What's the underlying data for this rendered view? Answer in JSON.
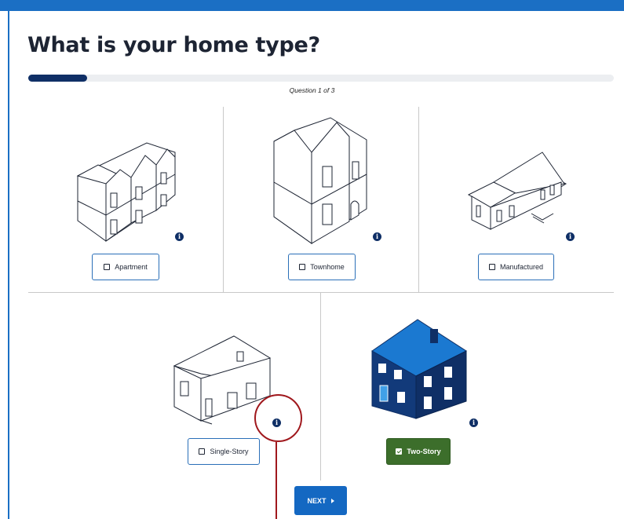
{
  "page": {
    "title": "What is your home type?",
    "progress_label": "Question 1 of 3",
    "progress_fraction": 0.1
  },
  "options": [
    {
      "label": "Apartment",
      "selected": false,
      "info": "i"
    },
    {
      "label": "Townhome",
      "selected": false,
      "info": "i"
    },
    {
      "label": "Manufactured",
      "selected": false,
      "info": "i"
    },
    {
      "label": "Single-Story",
      "selected": false,
      "info": "i"
    },
    {
      "label": "Two-Story",
      "selected": true,
      "info": "i"
    }
  ],
  "next_button": {
    "label": "NEXT"
  },
  "colors": {
    "brand_blue": "#1b6fc4",
    "navy": "#0f2f66",
    "selected_green": "#3c6e2b",
    "annotation_red": "#a0181d"
  },
  "icons": [
    "info-icon",
    "checkbox-icon",
    "checkbox-checked-icon",
    "chevron-right-icon",
    "apartment-house-icon",
    "townhome-house-icon",
    "manufactured-house-icon",
    "single-story-house-icon",
    "two-story-house-icon"
  ]
}
